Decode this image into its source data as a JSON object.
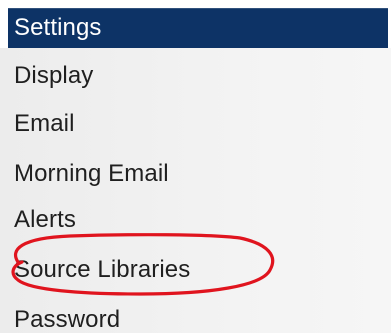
{
  "panel": {
    "title": "Settings",
    "accent_color": "#0d3366",
    "highlight_color": "#e0141e"
  },
  "menu": {
    "items": [
      {
        "label": "Display"
      },
      {
        "label": "Email"
      },
      {
        "label": "Morning Email"
      },
      {
        "label": "Alerts"
      },
      {
        "label": "Source Libraries",
        "highlighted": true
      },
      {
        "label": "Password"
      }
    ]
  }
}
